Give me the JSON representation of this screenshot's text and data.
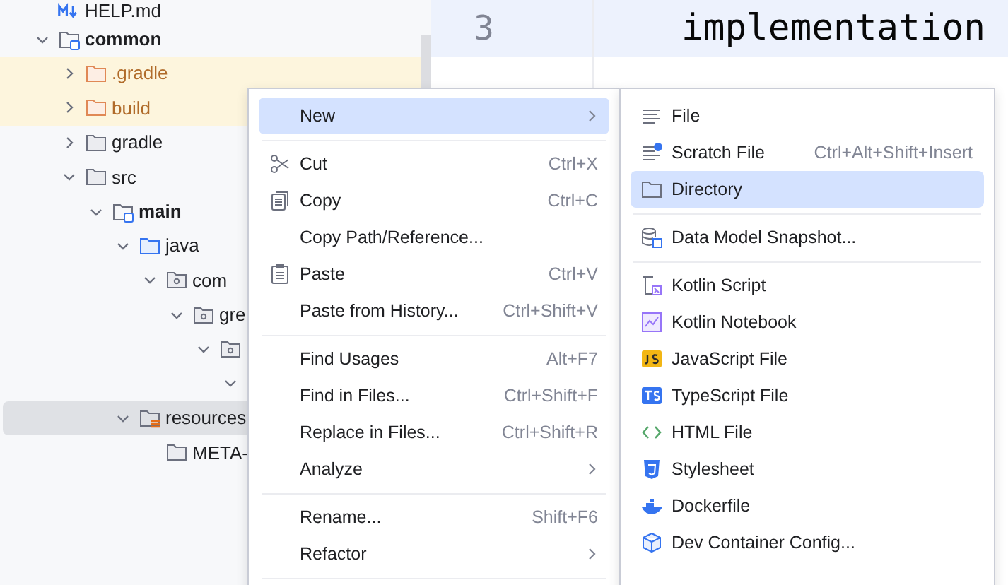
{
  "project_tree": {
    "items": [
      {
        "label": "HELP.md",
        "kind": "markdown",
        "selected": false
      },
      {
        "label": "common",
        "kind": "module",
        "expanded": true,
        "selected": false,
        "children": [
          {
            "label": ".gradle",
            "kind": "excluded",
            "expanded": false,
            "selected": false
          },
          {
            "label": "build",
            "kind": "excluded",
            "expanded": false,
            "selected": false
          },
          {
            "label": "gradle",
            "kind": "folder",
            "expanded": false,
            "selected": false
          },
          {
            "label": "src",
            "kind": "folder",
            "expanded": true,
            "selected": false,
            "children": [
              {
                "label": "main",
                "kind": "module",
                "expanded": true,
                "selected": false,
                "children": [
                  {
                    "label": "java",
                    "kind": "source",
                    "expanded": true,
                    "selected": false,
                    "children": [
                      {
                        "label": "com",
                        "kind": "package",
                        "expanded": true,
                        "selected": false,
                        "children": [
                          {
                            "label": "gre",
                            "kind": "package",
                            "expanded": true,
                            "selected": false,
                            "children": [
                              {
                                "kind": "package",
                                "expanded": true,
                                "selected": false,
                                "children": [
                                  {
                                    "expanded": true,
                                    "selected": false
                                  }
                                ]
                              }
                            ]
                          }
                        ]
                      }
                    ]
                  },
                  {
                    "label": "resources",
                    "kind": "resources",
                    "expanded": true,
                    "selected": true,
                    "children": [
                      {
                        "label": "META-",
                        "kind": "folder",
                        "selected": false
                      }
                    ]
                  }
                ]
              }
            ]
          }
        ]
      }
    ]
  },
  "editor": {
    "lines": [
      {
        "number": "3",
        "code": "implementation",
        "current": true
      }
    ]
  },
  "context_menu": {
    "items": [
      {
        "kind": "item",
        "label": "New",
        "selected": true,
        "submenu": true
      },
      {
        "kind": "separator"
      },
      {
        "kind": "item",
        "label": "Cut",
        "shortcut": "Ctrl+X",
        "selected": false,
        "submenu": false
      },
      {
        "kind": "item",
        "label": "Copy",
        "shortcut": "Ctrl+C",
        "selected": false,
        "submenu": false
      },
      {
        "kind": "item",
        "label": "Copy Path/Reference...",
        "selected": false,
        "submenu": false
      },
      {
        "kind": "item",
        "label": "Paste",
        "shortcut": "Ctrl+V",
        "selected": false,
        "submenu": false
      },
      {
        "kind": "item",
        "label": "Paste from History...",
        "shortcut": "Ctrl+Shift+V",
        "selected": false,
        "submenu": false
      },
      {
        "kind": "separator"
      },
      {
        "kind": "item",
        "label": "Find Usages",
        "shortcut": "Alt+F7",
        "selected": false,
        "submenu": false
      },
      {
        "kind": "item",
        "label": "Find in Files...",
        "shortcut": "Ctrl+Shift+F",
        "selected": false,
        "submenu": false
      },
      {
        "kind": "item",
        "label": "Replace in Files...",
        "shortcut": "Ctrl+Shift+R",
        "selected": false,
        "submenu": false
      },
      {
        "kind": "item",
        "label": "Analyze",
        "selected": false,
        "submenu": true
      },
      {
        "kind": "separator"
      },
      {
        "kind": "item",
        "label": "Rename...",
        "shortcut": "Shift+F6",
        "selected": false,
        "submenu": false
      },
      {
        "kind": "item",
        "label": "Refactor",
        "selected": false,
        "submenu": true
      },
      {
        "kind": "separator"
      }
    ]
  },
  "new_submenu": {
    "items": [
      {
        "kind": "item",
        "label": "File",
        "selected": false
      },
      {
        "kind": "item",
        "label": "Scratch File",
        "shortcut": "Ctrl+Alt+Shift+Insert",
        "selected": false
      },
      {
        "kind": "item",
        "label": "Directory",
        "selected": true
      },
      {
        "kind": "separator"
      },
      {
        "kind": "item",
        "label": "Data Model Snapshot...",
        "selected": false
      },
      {
        "kind": "separator"
      },
      {
        "kind": "item",
        "label": "Kotlin Script",
        "selected": false
      },
      {
        "kind": "item",
        "label": "Kotlin Notebook",
        "selected": false
      },
      {
        "kind": "item",
        "label": "JavaScript File",
        "selected": false
      },
      {
        "kind": "item",
        "label": "TypeScript File",
        "selected": false
      },
      {
        "kind": "item",
        "label": "HTML File",
        "selected": false
      },
      {
        "kind": "item",
        "label": "Stylesheet",
        "selected": false
      },
      {
        "kind": "item",
        "label": "Dockerfile",
        "selected": false
      },
      {
        "kind": "item",
        "label": "Dev Container Config...",
        "selected": false
      }
    ]
  }
}
